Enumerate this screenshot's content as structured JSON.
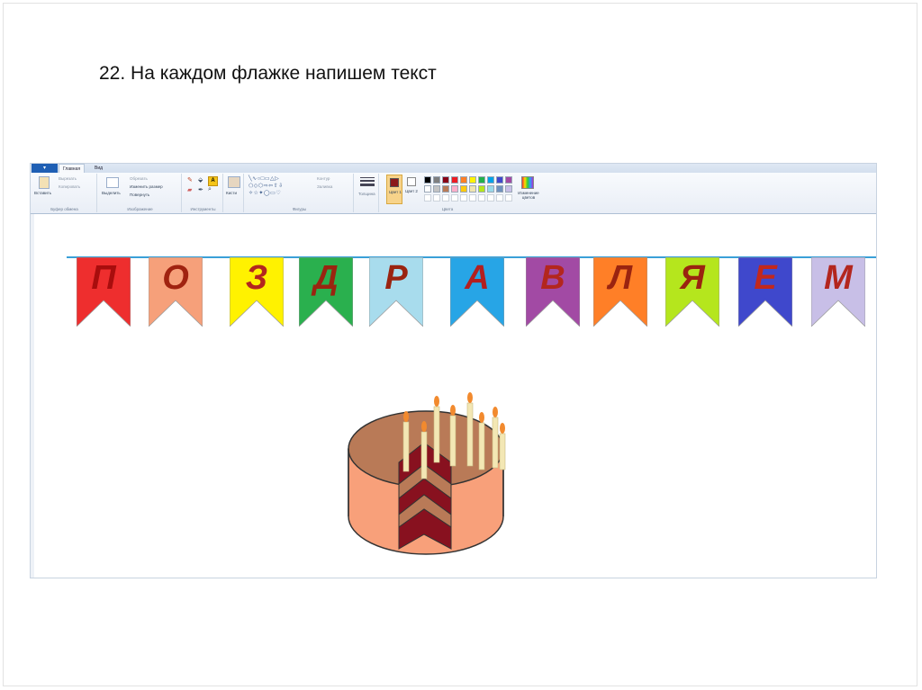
{
  "slide": {
    "title": "22. На каждом флажке напишем текст"
  },
  "paint": {
    "file_button": "▾",
    "tabs": [
      {
        "label": "Главная",
        "active": true
      },
      {
        "label": "Вид",
        "active": false
      }
    ],
    "ribbon": {
      "clipboard": {
        "label": "Буфер обмена",
        "paste": "Вставить",
        "cut": "Вырезать",
        "copy": "Копировать"
      },
      "image": {
        "label": "Изображение",
        "select": "Выделить",
        "crop": "Обрезать",
        "resize": "Изменить размер",
        "rotate": "Повернуть"
      },
      "tools": {
        "label": "Инструменты"
      },
      "brushes": {
        "label": "Кисти"
      },
      "shapes": {
        "label": "Фигуры",
        "outline": "Контур",
        "fill": "Заливка"
      },
      "size": {
        "label": "Толщина"
      },
      "colors": {
        "label": "Цвета",
        "color1": "Цвет 1",
        "color2": "Цвет 2",
        "edit": "Изменение цветов",
        "color1_value": "#8b1a1a",
        "color2_value": "#ffffff",
        "palette_row1": [
          "#000000",
          "#7f7f7f",
          "#880015",
          "#ed1c24",
          "#ff7f27",
          "#fff200",
          "#22b14c",
          "#00a2e8",
          "#3f48cc",
          "#a349a4"
        ],
        "palette_row2": [
          "#ffffff",
          "#c3c3c3",
          "#b97a57",
          "#ffaec9",
          "#ffc90e",
          "#efe4b0",
          "#b5e61d",
          "#99d9ea",
          "#7092be",
          "#c8bfe7"
        ]
      }
    },
    "banner": {
      "flags": [
        {
          "letter": "П",
          "color": "#ee2e2e",
          "text_color": "#a80d0d"
        },
        {
          "letter": "О",
          "color": "#f6a07a",
          "text_color": "#a02310"
        },
        {
          "letter": "З",
          "color": "#fff200",
          "text_color": "#b3261e"
        },
        {
          "letter": "Д",
          "color": "#2ab04e",
          "text_color": "#9a2410"
        },
        {
          "letter": "Р",
          "color": "#a8dced",
          "text_color": "#9a2410"
        },
        {
          "letter": "А",
          "color": "#27a5e6",
          "text_color": "#b31f1f"
        },
        {
          "letter": "В",
          "color": "#a24aa4",
          "text_color": "#b3261e"
        },
        {
          "letter": "Л",
          "color": "#ff7f27",
          "text_color": "#9a2410"
        },
        {
          "letter": "Я",
          "color": "#b5e61d",
          "text_color": "#9a2410"
        },
        {
          "letter": "Е",
          "color": "#3f48cc",
          "text_color": "#c2281c"
        },
        {
          "letter": "М",
          "color": "#c8bfe7",
          "text_color": "#b3261e"
        }
      ]
    },
    "cake": {
      "top_color": "#b97a57",
      "side_color": "#f8a07a",
      "layer_dark": "#88111f",
      "layer_light": "#b97a57",
      "candle_color": "#f3e7b4",
      "flame_color": "#f28a2e"
    }
  }
}
